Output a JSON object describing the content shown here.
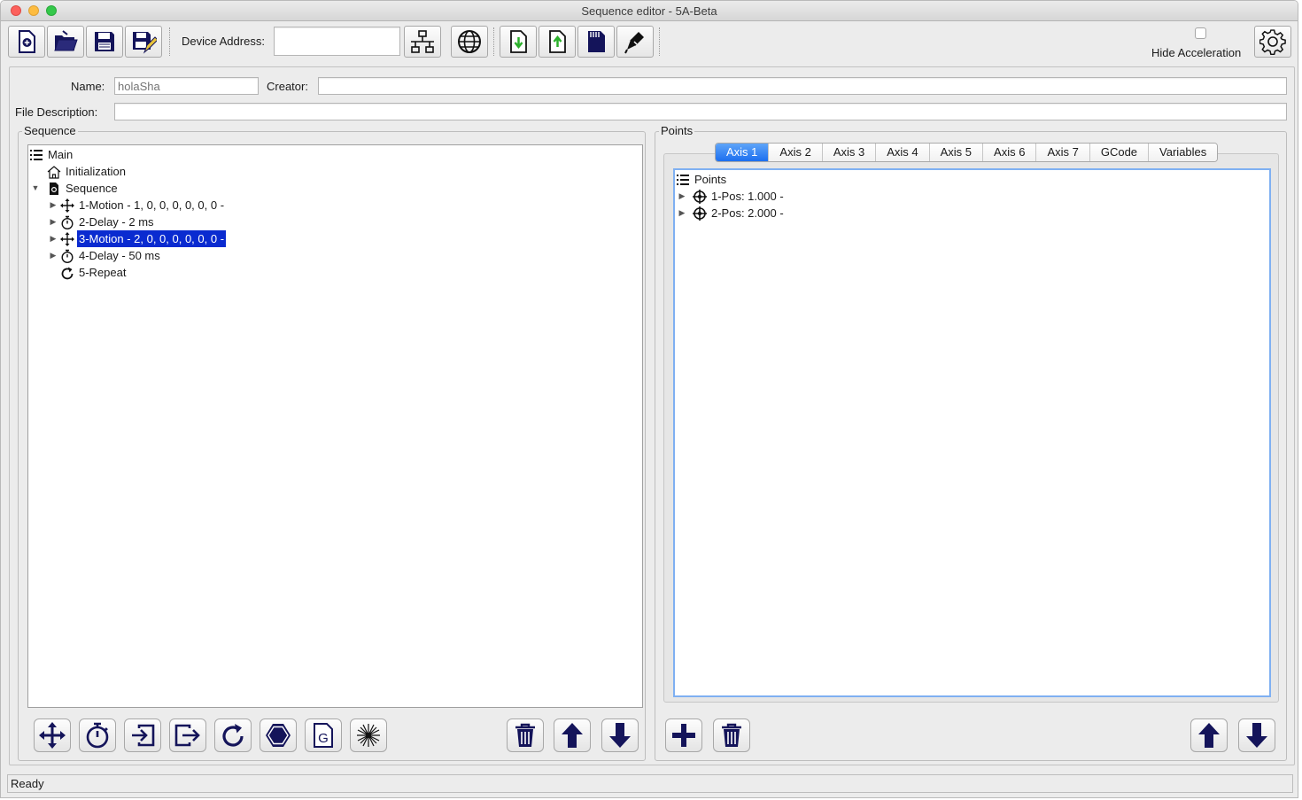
{
  "window": {
    "title": "Sequence editor - 5A-Beta"
  },
  "toolbar": {
    "device_address_label": "Device Address:",
    "device_address_value": "",
    "hide_acceleration_label": "Hide Acceleration",
    "hide_acceleration_checked": false,
    "buttons": [
      {
        "name": "new-file",
        "icon": "new-file-icon"
      },
      {
        "name": "open-folder",
        "icon": "folder-open-icon"
      },
      {
        "name": "save",
        "icon": "floppy-disk-icon"
      },
      {
        "name": "save-as",
        "icon": "floppy-disk-pencil-icon"
      },
      {
        "name": "network",
        "icon": "network-tree-icon"
      },
      {
        "name": "web",
        "icon": "globe-icon"
      },
      {
        "name": "download",
        "icon": "file-download-icon"
      },
      {
        "name": "upload",
        "icon": "file-upload-icon"
      },
      {
        "name": "sd-card",
        "icon": "sd-card-icon"
      },
      {
        "name": "edit",
        "icon": "pen-icon"
      },
      {
        "name": "settings",
        "icon": "gear-icon"
      }
    ]
  },
  "form": {
    "name_label": "Name:",
    "name_placeholder": "holaSha",
    "creator_label": "Creator:",
    "creator_value": "",
    "file_description_label": "File Description:",
    "file_description_value": ""
  },
  "sequence": {
    "title": "Sequence",
    "tree": [
      {
        "label": "Main",
        "icon": "list-icon",
        "level": 0,
        "arrow": ""
      },
      {
        "label": "Initialization",
        "icon": "home-icon",
        "level": 1,
        "arrow": ""
      },
      {
        "label": "Sequence",
        "icon": "sequence-doc-icon",
        "level": 1,
        "arrow": "expanded"
      },
      {
        "label": "1-Motion - 1, 0, 0, 0, 0, 0, 0 -",
        "icon": "move-arrows-icon",
        "level": 2,
        "arrow": "collapsed"
      },
      {
        "label": "2-Delay - 2 ms",
        "icon": "stopwatch-icon",
        "level": 2,
        "arrow": "collapsed"
      },
      {
        "label": "3-Motion - 2, 0, 0, 0, 0, 0, 0 -",
        "icon": "move-arrows-icon",
        "level": 2,
        "arrow": "collapsed",
        "selected": true
      },
      {
        "label": "4-Delay - 50 ms",
        "icon": "stopwatch-icon",
        "level": 2,
        "arrow": "collapsed"
      },
      {
        "label": "5-Repeat",
        "icon": "repeat-icon",
        "level": 2,
        "arrow": ""
      }
    ],
    "buttons": [
      {
        "name": "add-motion",
        "icon": "move-arrows-icon"
      },
      {
        "name": "add-delay",
        "icon": "stopwatch-icon"
      },
      {
        "name": "add-input",
        "icon": "input-icon"
      },
      {
        "name": "add-output",
        "icon": "output-icon"
      },
      {
        "name": "add-repeat",
        "icon": "repeat-icon"
      },
      {
        "name": "add-stop",
        "icon": "stop-hexagon-icon"
      },
      {
        "name": "add-gcode",
        "icon": "gcode-icon"
      },
      {
        "name": "add-laser",
        "icon": "laser-icon"
      },
      {
        "name": "delete",
        "icon": "trash-icon"
      },
      {
        "name": "move-up",
        "icon": "arrow-up-icon"
      },
      {
        "name": "move-down",
        "icon": "arrow-down-icon"
      }
    ]
  },
  "points": {
    "title": "Points",
    "tabs": [
      "Axis 1",
      "Axis 2",
      "Axis 3",
      "Axis 4",
      "Axis 5",
      "Axis 6",
      "Axis 7",
      "GCode",
      "Variables"
    ],
    "active_tab": "Axis 1",
    "tree": [
      {
        "label": "Points",
        "icon": "list-icon",
        "level": 0,
        "arrow": ""
      },
      {
        "label": "1-Pos: 1.000 -",
        "icon": "crosshair-icon",
        "level": 1,
        "arrow": "collapsed"
      },
      {
        "label": "2-Pos: 2.000 -",
        "icon": "crosshair-icon",
        "level": 1,
        "arrow": "collapsed"
      }
    ],
    "buttons": [
      {
        "name": "add-point",
        "icon": "plus-icon"
      },
      {
        "name": "delete-point",
        "icon": "trash-icon"
      },
      {
        "name": "point-up",
        "icon": "arrow-up-icon"
      },
      {
        "name": "point-down",
        "icon": "arrow-down-icon"
      }
    ]
  },
  "status": {
    "text": "Ready"
  },
  "colors": {
    "icon_navy": "#14145a",
    "selection": "#0a2bd0",
    "tab_active": "#1c6ff0",
    "green_arrow": "#2bb02b"
  }
}
